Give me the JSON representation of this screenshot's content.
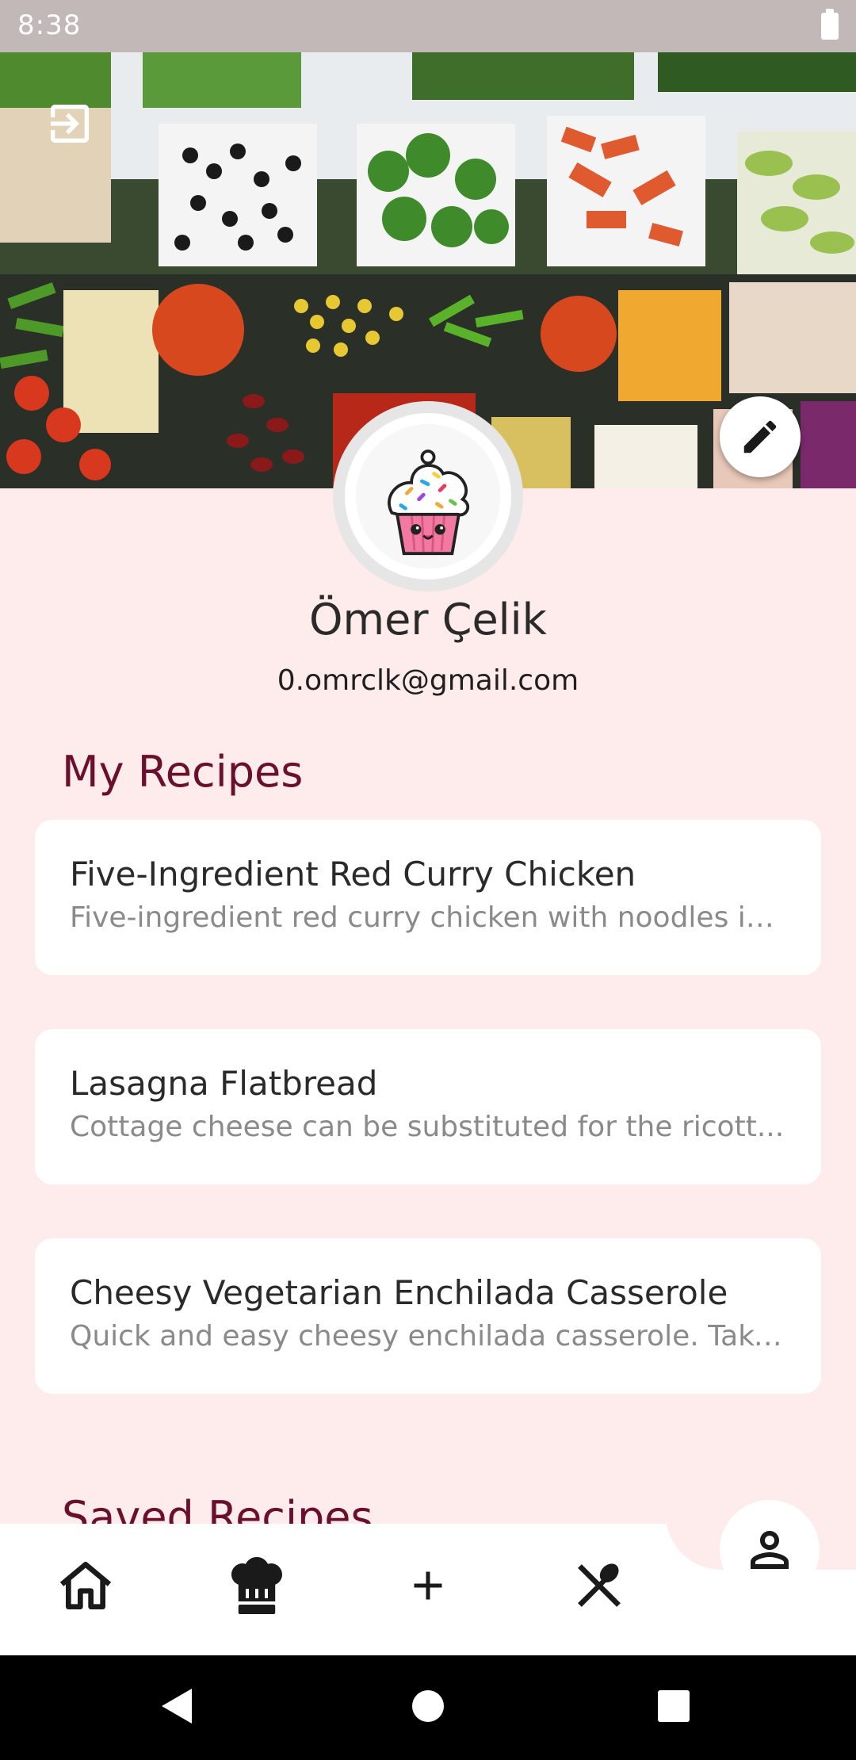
{
  "status_bar": {
    "time": "8:38"
  },
  "profile": {
    "name": "Ömer Çelik",
    "email": "0.omrclk@gmail.com"
  },
  "sections": {
    "my_recipes": "My Recipes",
    "saved_recipes": "Saved Recipes"
  },
  "my_recipes": [
    {
      "title": "Five-Ingredient Red Curry Chicken",
      "description": "Five-ingredient red curry chicken with noodles is..."
    },
    {
      "title": "Lasagna Flatbread",
      "description": "Cottage cheese can be substituted for the ricott..."
    },
    {
      "title": "Cheesy Vegetarian Enchilada Casserole",
      "description": "Quick and easy cheesy enchilada casserole. Take..."
    }
  ],
  "icons": {
    "logout": "logout-icon",
    "edit": "pencil-icon",
    "nav": [
      "home-icon",
      "chef-hat-icon",
      "plus-icon",
      "utensils-icon",
      "person-icon"
    ]
  },
  "colors": {
    "background": "#fdeceb",
    "section_title": "#6b0f2e",
    "card": "#ffffff"
  }
}
